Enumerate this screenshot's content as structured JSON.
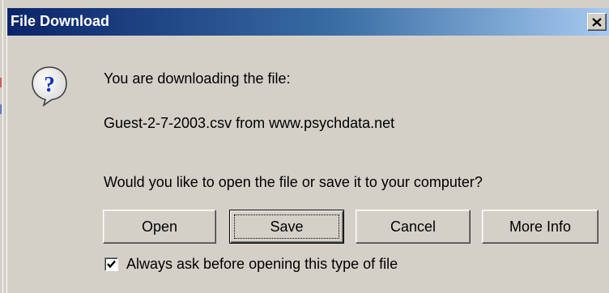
{
  "window": {
    "title": "File Download",
    "close_icon": "close-icon"
  },
  "message": {
    "icon": "question-icon",
    "line1": "You are downloading the file:",
    "file_line": "Guest-2-7-2003.csv from www.psychdata.net",
    "prompt": "Would you like to open the file or save it to your computer?"
  },
  "buttons": {
    "open": "Open",
    "save": "Save",
    "cancel": "Cancel",
    "more_info": "More Info"
  },
  "checkbox": {
    "label": "Always ask before opening this type of file",
    "checked": true
  },
  "colors": {
    "title_gradient_start": "#0a246a",
    "title_gradient_end": "#a6caf0",
    "face": "#d4d0c8"
  }
}
